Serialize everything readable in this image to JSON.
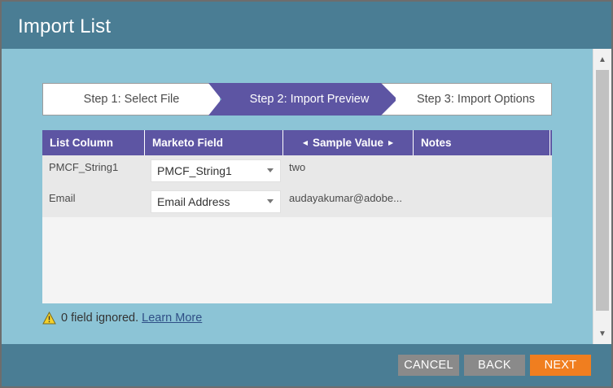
{
  "dialog": {
    "title": "Import List"
  },
  "steps": [
    {
      "label": "Step 1: Select File",
      "active": false
    },
    {
      "label": "Step 2: Import Preview",
      "active": true
    },
    {
      "label": "Step 3: Import Options",
      "active": false
    }
  ],
  "table": {
    "headers": {
      "list_column": "List Column",
      "marketo_field": "Marketo Field",
      "sample_value": "Sample Value",
      "notes": "Notes"
    },
    "rows": [
      {
        "list_column": "PMCF_String1",
        "marketo_field": "PMCF_String1",
        "sample_value": "two",
        "notes": ""
      },
      {
        "list_column": "Email",
        "marketo_field": "Email Address",
        "sample_value": "audayakumar@adobe...",
        "notes": ""
      }
    ]
  },
  "warning": {
    "text": "0 field ignored.",
    "link": "Learn More"
  },
  "footer": {
    "cancel": "CANCEL",
    "back": "BACK",
    "next": "NEXT"
  },
  "colors": {
    "header": "#4a7d94",
    "accent": "#5d55a3",
    "next": "#f07e1f",
    "secondary": "#8a8a8a"
  },
  "icons": [
    "warning-icon",
    "chevron-left-icon",
    "chevron-right-icon",
    "dropdown-caret-icon",
    "scroll-up-icon",
    "scroll-down-icon"
  ]
}
